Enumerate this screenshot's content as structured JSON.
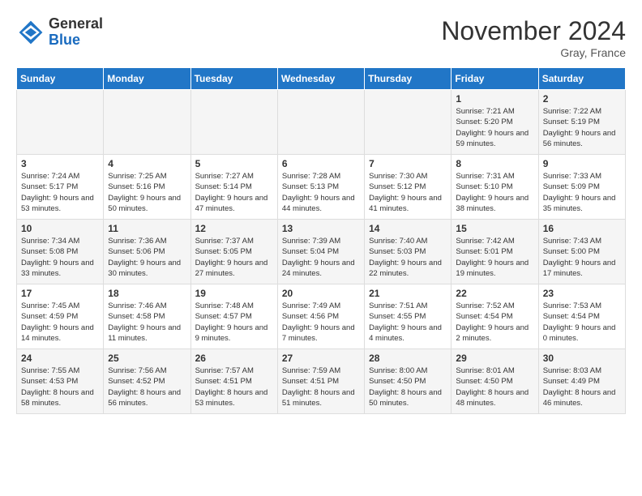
{
  "header": {
    "logo_general": "General",
    "logo_blue": "Blue",
    "month": "November 2024",
    "location": "Gray, France"
  },
  "weekdays": [
    "Sunday",
    "Monday",
    "Tuesday",
    "Wednesday",
    "Thursday",
    "Friday",
    "Saturday"
  ],
  "weeks": [
    [
      {
        "day": "",
        "info": ""
      },
      {
        "day": "",
        "info": ""
      },
      {
        "day": "",
        "info": ""
      },
      {
        "day": "",
        "info": ""
      },
      {
        "day": "",
        "info": ""
      },
      {
        "day": "1",
        "info": "Sunrise: 7:21 AM\nSunset: 5:20 PM\nDaylight: 9 hours and 59 minutes."
      },
      {
        "day": "2",
        "info": "Sunrise: 7:22 AM\nSunset: 5:19 PM\nDaylight: 9 hours and 56 minutes."
      }
    ],
    [
      {
        "day": "3",
        "info": "Sunrise: 7:24 AM\nSunset: 5:17 PM\nDaylight: 9 hours and 53 minutes."
      },
      {
        "day": "4",
        "info": "Sunrise: 7:25 AM\nSunset: 5:16 PM\nDaylight: 9 hours and 50 minutes."
      },
      {
        "day": "5",
        "info": "Sunrise: 7:27 AM\nSunset: 5:14 PM\nDaylight: 9 hours and 47 minutes."
      },
      {
        "day": "6",
        "info": "Sunrise: 7:28 AM\nSunset: 5:13 PM\nDaylight: 9 hours and 44 minutes."
      },
      {
        "day": "7",
        "info": "Sunrise: 7:30 AM\nSunset: 5:12 PM\nDaylight: 9 hours and 41 minutes."
      },
      {
        "day": "8",
        "info": "Sunrise: 7:31 AM\nSunset: 5:10 PM\nDaylight: 9 hours and 38 minutes."
      },
      {
        "day": "9",
        "info": "Sunrise: 7:33 AM\nSunset: 5:09 PM\nDaylight: 9 hours and 35 minutes."
      }
    ],
    [
      {
        "day": "10",
        "info": "Sunrise: 7:34 AM\nSunset: 5:08 PM\nDaylight: 9 hours and 33 minutes."
      },
      {
        "day": "11",
        "info": "Sunrise: 7:36 AM\nSunset: 5:06 PM\nDaylight: 9 hours and 30 minutes."
      },
      {
        "day": "12",
        "info": "Sunrise: 7:37 AM\nSunset: 5:05 PM\nDaylight: 9 hours and 27 minutes."
      },
      {
        "day": "13",
        "info": "Sunrise: 7:39 AM\nSunset: 5:04 PM\nDaylight: 9 hours and 24 minutes."
      },
      {
        "day": "14",
        "info": "Sunrise: 7:40 AM\nSunset: 5:03 PM\nDaylight: 9 hours and 22 minutes."
      },
      {
        "day": "15",
        "info": "Sunrise: 7:42 AM\nSunset: 5:01 PM\nDaylight: 9 hours and 19 minutes."
      },
      {
        "day": "16",
        "info": "Sunrise: 7:43 AM\nSunset: 5:00 PM\nDaylight: 9 hours and 17 minutes."
      }
    ],
    [
      {
        "day": "17",
        "info": "Sunrise: 7:45 AM\nSunset: 4:59 PM\nDaylight: 9 hours and 14 minutes."
      },
      {
        "day": "18",
        "info": "Sunrise: 7:46 AM\nSunset: 4:58 PM\nDaylight: 9 hours and 11 minutes."
      },
      {
        "day": "19",
        "info": "Sunrise: 7:48 AM\nSunset: 4:57 PM\nDaylight: 9 hours and 9 minutes."
      },
      {
        "day": "20",
        "info": "Sunrise: 7:49 AM\nSunset: 4:56 PM\nDaylight: 9 hours and 7 minutes."
      },
      {
        "day": "21",
        "info": "Sunrise: 7:51 AM\nSunset: 4:55 PM\nDaylight: 9 hours and 4 minutes."
      },
      {
        "day": "22",
        "info": "Sunrise: 7:52 AM\nSunset: 4:54 PM\nDaylight: 9 hours and 2 minutes."
      },
      {
        "day": "23",
        "info": "Sunrise: 7:53 AM\nSunset: 4:54 PM\nDaylight: 9 hours and 0 minutes."
      }
    ],
    [
      {
        "day": "24",
        "info": "Sunrise: 7:55 AM\nSunset: 4:53 PM\nDaylight: 8 hours and 58 minutes."
      },
      {
        "day": "25",
        "info": "Sunrise: 7:56 AM\nSunset: 4:52 PM\nDaylight: 8 hours and 56 minutes."
      },
      {
        "day": "26",
        "info": "Sunrise: 7:57 AM\nSunset: 4:51 PM\nDaylight: 8 hours and 53 minutes."
      },
      {
        "day": "27",
        "info": "Sunrise: 7:59 AM\nSunset: 4:51 PM\nDaylight: 8 hours and 51 minutes."
      },
      {
        "day": "28",
        "info": "Sunrise: 8:00 AM\nSunset: 4:50 PM\nDaylight: 8 hours and 50 minutes."
      },
      {
        "day": "29",
        "info": "Sunrise: 8:01 AM\nSunset: 4:50 PM\nDaylight: 8 hours and 48 minutes."
      },
      {
        "day": "30",
        "info": "Sunrise: 8:03 AM\nSunset: 4:49 PM\nDaylight: 8 hours and 46 minutes."
      }
    ]
  ]
}
